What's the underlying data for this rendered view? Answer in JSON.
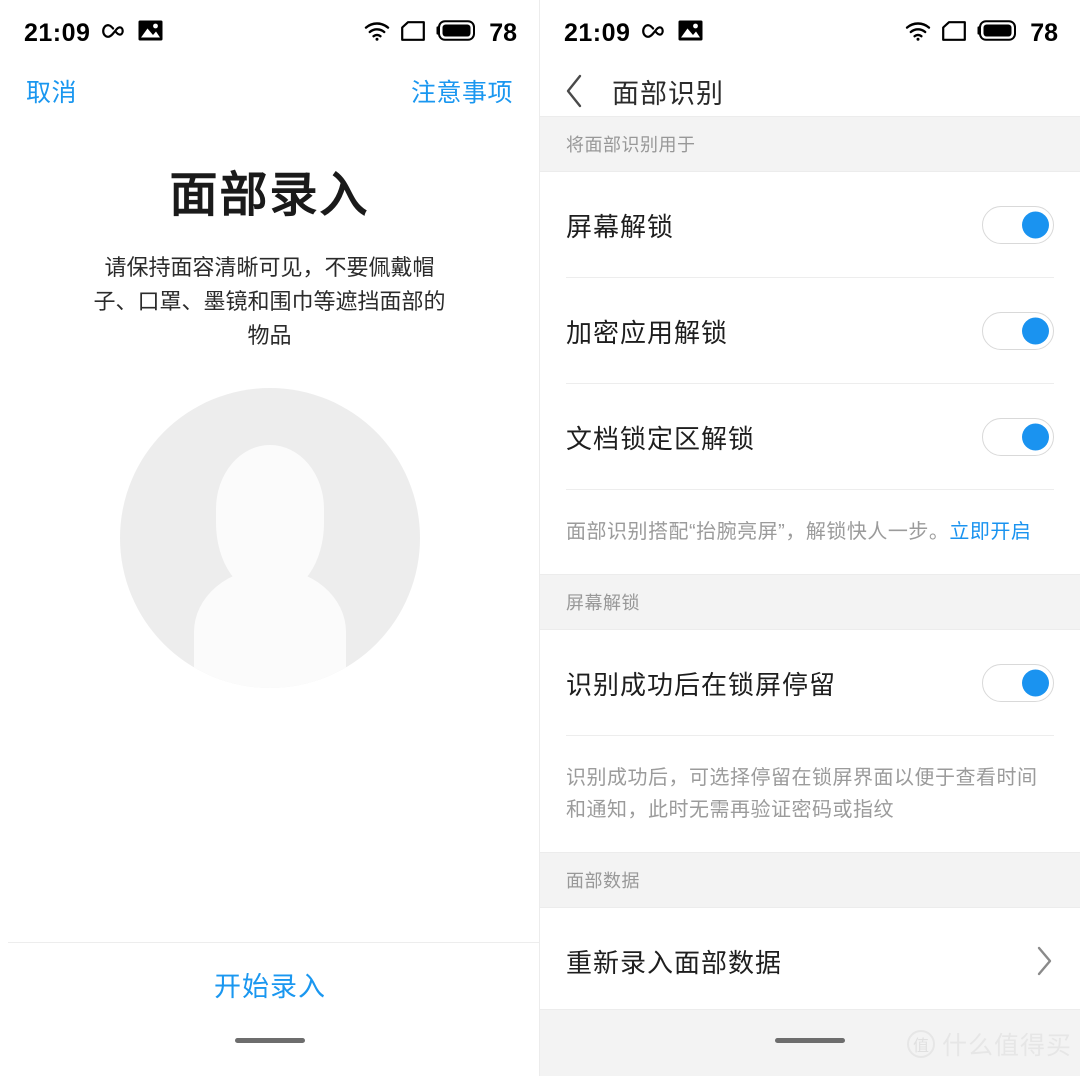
{
  "status_bar": {
    "time": "21:09",
    "battery_level": "78",
    "icons": [
      "infinity-icon",
      "screenshot-icon",
      "wifi-icon",
      "sim-signal-icon",
      "battery-icon"
    ]
  },
  "colors": {
    "accent_blue": "#1a93f0",
    "link_blue": "#1a97f0",
    "section_header_bg": "#f3f3f3",
    "divider": "#ededed",
    "avatar_bg": "#ededed",
    "muted_text": "#9b9b9b"
  },
  "left_screen": {
    "cancel_label": "取消",
    "notice_label": "注意事项",
    "title": "面部录入",
    "description": "请保持面容清晰可见，不要佩戴帽子、口罩、墨镜和围巾等遮挡面部的物品",
    "avatar_icon": "face-placeholder-icon",
    "start_button_label": "开始录入"
  },
  "right_screen": {
    "nav_title": "面部识别",
    "back_icon": "chevron-left-icon",
    "sections": [
      {
        "header": "将面部识别用于",
        "rows": [
          {
            "label": "屏幕解锁",
            "type": "toggle",
            "value": "on"
          },
          {
            "label": "加密应用解锁",
            "type": "toggle",
            "value": "on"
          },
          {
            "label": "文档锁定区解锁",
            "type": "toggle",
            "value": "on"
          }
        ],
        "hint_text": "面部识别搭配“抬腕亮屏”，解锁快人一步。",
        "hint_link": "立即开启"
      },
      {
        "header": "屏幕解锁",
        "rows": [
          {
            "label": "识别成功后在锁屏停留",
            "type": "toggle",
            "value": "on"
          }
        ],
        "hint_text": "识别成功后，可选择停留在锁屏界面以便于查看时间和通知，此时无需再验证密码或指纹",
        "hint_link": ""
      },
      {
        "header": "面部数据",
        "rows": [
          {
            "label": "重新录入面部数据",
            "type": "link",
            "value": "chevron-right-icon"
          }
        ],
        "hint_text": "",
        "hint_link": ""
      }
    ]
  },
  "watermark": {
    "badge": "值",
    "text": "什么值得买"
  }
}
